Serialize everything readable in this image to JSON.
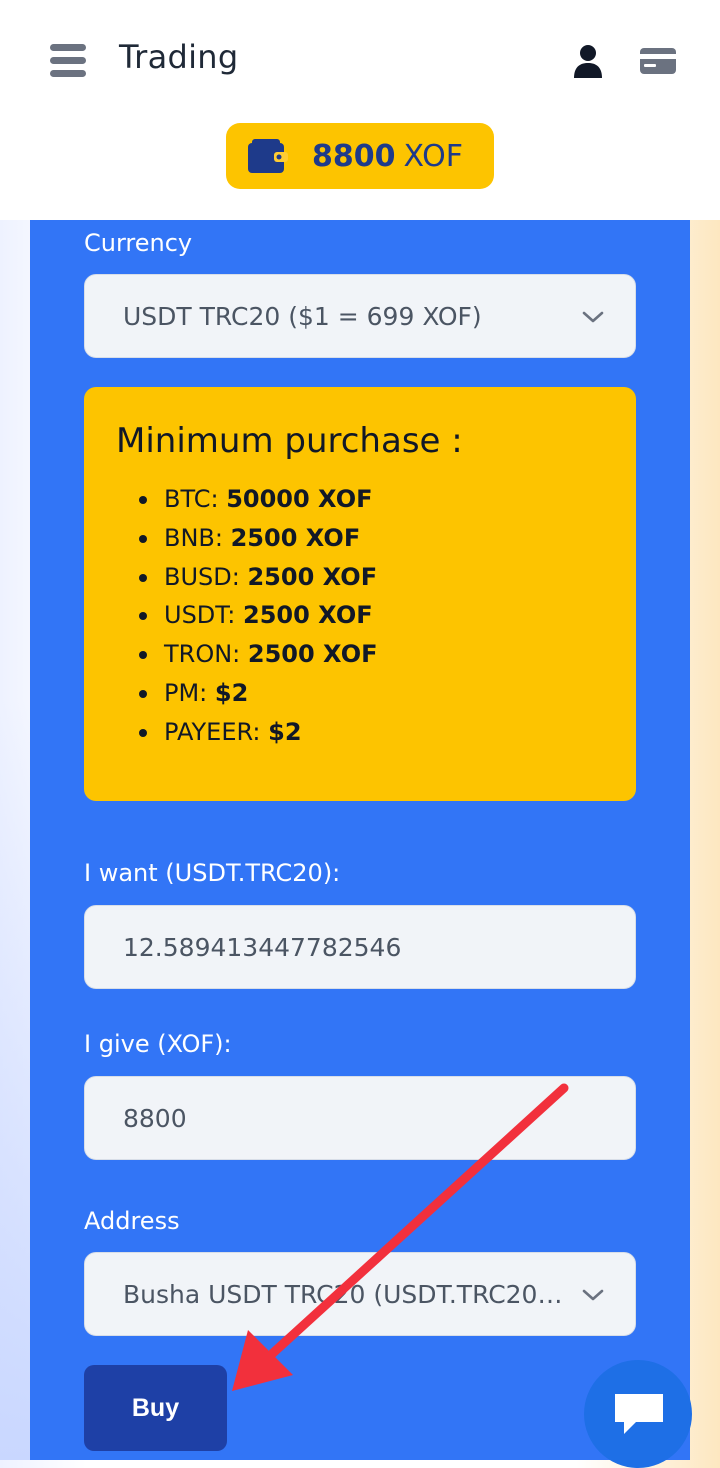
{
  "header": {
    "title": "Trading",
    "balance_amount": "8800",
    "balance_currency": "XOF",
    "icons": [
      "menu-icon",
      "user-icon",
      "credit-card-icon",
      "wallet-icon"
    ]
  },
  "form": {
    "currency": {
      "label": "Currency",
      "selected": "USDT TRC20 ($1 = 699 XOF)"
    },
    "minimum": {
      "title": "Minimum purchase :",
      "items": [
        {
          "name": "BTC:",
          "value": "50000 XOF"
        },
        {
          "name": "BNB:",
          "value": "2500 XOF"
        },
        {
          "name": "BUSD:",
          "value": "2500 XOF"
        },
        {
          "name": "USDT:",
          "value": "2500 XOF"
        },
        {
          "name": "TRON:",
          "value": "2500 XOF"
        },
        {
          "name": "PM:",
          "value": "$2"
        },
        {
          "name": "PAYEER:",
          "value": "$2"
        }
      ]
    },
    "want": {
      "label": "I want (USDT.TRC20):",
      "value": "12.589413447782546"
    },
    "give": {
      "label": "I give (XOF):",
      "value": "8800"
    },
    "address": {
      "label": "Address",
      "selected": "Busha USDT TRC20 (USDT.TRC20 :..."
    },
    "buy_label": "Buy"
  },
  "colors": {
    "panel": "#3275f6",
    "accent_yellow": "#fdc400",
    "button": "#1e40a6",
    "annotation_arrow": "#f2303c"
  }
}
